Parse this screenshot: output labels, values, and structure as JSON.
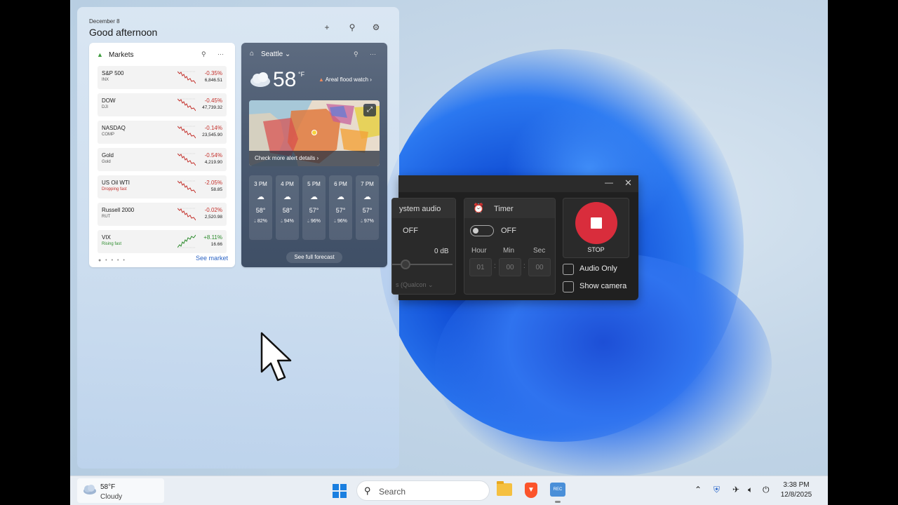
{
  "widgets": {
    "date": "December 8",
    "greeting": "Good afternoon",
    "header_icons": [
      "plus-icon",
      "people-icon",
      "gear-icon"
    ],
    "markets": {
      "title": "Markets",
      "rows": [
        {
          "name": "S&P 500",
          "symbol": "INX",
          "change": "-0.35%",
          "value": "6,846.51",
          "trend": "down"
        },
        {
          "name": "DOW",
          "symbol": "DJI",
          "change": "-0.45%",
          "value": "47,739.32",
          "trend": "down"
        },
        {
          "name": "NASDAQ",
          "symbol": "COMP",
          "change": "-0.14%",
          "value": "23,545.90",
          "trend": "down"
        },
        {
          "name": "Gold",
          "symbol": "Gold",
          "change": "-0.54%",
          "value": "4,219.90",
          "trend": "down"
        },
        {
          "name": "US Oil WTI",
          "symbol": "Dropping fast",
          "change": "-2.05%",
          "value": "58.85",
          "trend": "down"
        },
        {
          "name": "Russell 2000",
          "symbol": "RUT",
          "change": "-0.02%",
          "value": "2,520.98",
          "trend": "down"
        },
        {
          "name": "VIX",
          "symbol": "Rising fast",
          "change": "+8.11%",
          "value": "16.66",
          "trend": "up"
        }
      ],
      "see_more": "See market"
    },
    "weather": {
      "city": "Seattle",
      "temp": "58",
      "unit": "°F",
      "alert": "Areal flood watch",
      "map_caption": "Check more alert details",
      "hours": [
        {
          "time": "3 PM",
          "temp": "58°",
          "precip": "82%"
        },
        {
          "time": "4 PM",
          "temp": "58°",
          "precip": "94%"
        },
        {
          "time": "5 PM",
          "temp": "57°",
          "precip": "96%"
        },
        {
          "time": "6 PM",
          "temp": "57°",
          "precip": "96%"
        },
        {
          "time": "7 PM",
          "temp": "57°",
          "precip": "97%"
        }
      ],
      "see_forecast": "See full forecast"
    }
  },
  "recorder": {
    "audio_label": "ystem audio",
    "audio_state": "OFF",
    "audio_db": "0 dB",
    "audio_device": "s (Qualcon",
    "timer_label": "Timer",
    "timer_state": "OFF",
    "hour_label": "Hour",
    "min_label": "Min",
    "sec_label": "Sec",
    "hour_value": "01",
    "min_value": "00",
    "sec_value": "00",
    "stop_label": "STOP",
    "audio_only_label": "Audio Only",
    "show_camera_label": "Show camera"
  },
  "taskbar": {
    "weather_temp": "58°F",
    "weather_cond": "Cloudy",
    "search_placeholder": "Search",
    "time": "3:38 PM",
    "date": "12/8/2025"
  }
}
